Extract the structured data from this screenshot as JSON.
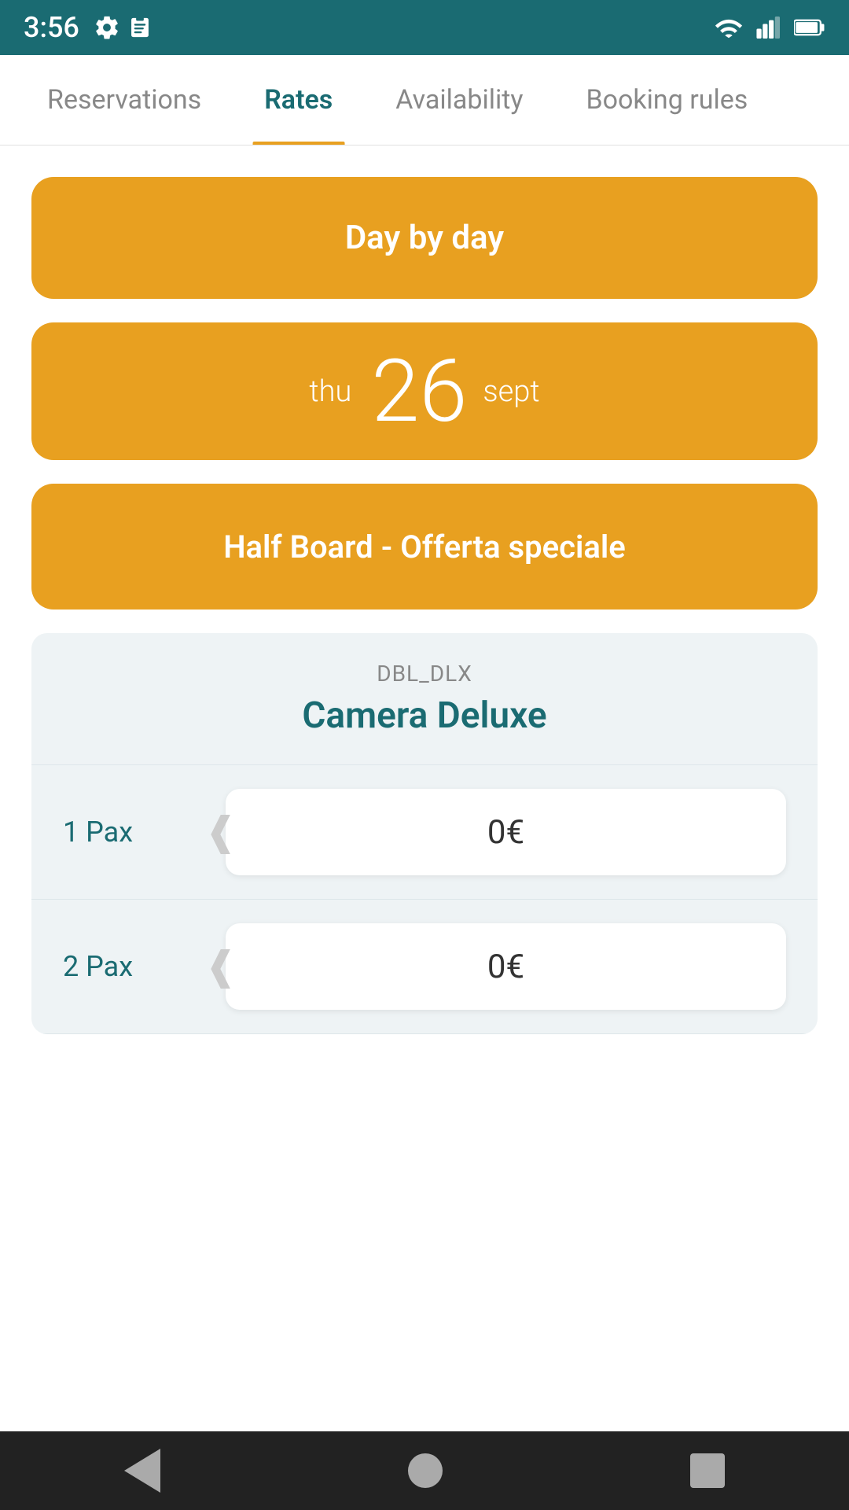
{
  "statusBar": {
    "time": "3:56",
    "icons": [
      "gear",
      "clipboard",
      "wifi",
      "signal",
      "battery"
    ]
  },
  "nav": {
    "tabs": [
      {
        "id": "reservations",
        "label": "Reservations",
        "active": false
      },
      {
        "id": "rates",
        "label": "Rates",
        "active": true
      },
      {
        "id": "availability",
        "label": "Availability",
        "active": false
      },
      {
        "id": "booking-rules",
        "label": "Booking rules",
        "active": false
      }
    ]
  },
  "buttons": {
    "dayByDay": "Day by day",
    "dateDay": "thu",
    "dateNumber": "26",
    "dateMonth": "sept",
    "mealPlan": "Half Board - Offerta speciale"
  },
  "roomCard": {
    "code": "DBL_DLX",
    "name": "Camera Deluxe",
    "paxRows": [
      {
        "label": "1 Pax",
        "value": "0€"
      },
      {
        "label": "2 Pax",
        "value": "0€"
      }
    ]
  },
  "bottomNav": {
    "back": "back",
    "home": "home",
    "recent": "recent"
  }
}
